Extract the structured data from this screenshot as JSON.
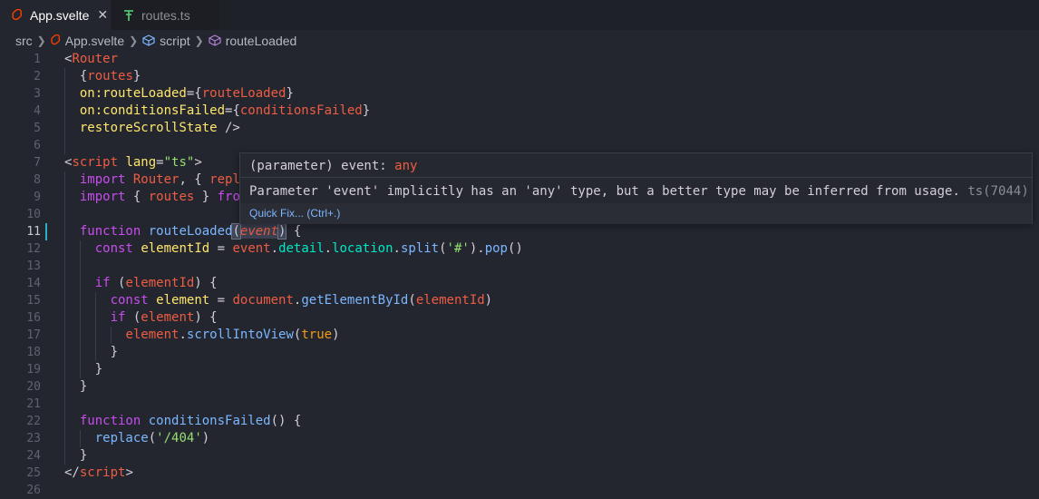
{
  "tabs": [
    {
      "label": "App.svelte",
      "icon": "svelte-icon",
      "active": true
    },
    {
      "label": "routes.ts",
      "icon": "typescript-icon",
      "active": false
    }
  ],
  "breadcrumb": {
    "items": [
      "src",
      "App.svelte",
      "script",
      "routeLoaded"
    ]
  },
  "editor": {
    "line_numbers": [
      "1",
      "2",
      "3",
      "4",
      "5",
      "6",
      "7",
      "8",
      "9",
      "10",
      "11",
      "12",
      "13",
      "14",
      "15",
      "16",
      "17",
      "18",
      "19",
      "20",
      "21",
      "22",
      "23",
      "24",
      "25",
      "26"
    ],
    "active_line": "11"
  },
  "hover": {
    "signature_prefix": "(parameter) event: ",
    "signature_type": "any",
    "message": "Parameter 'event' implicitly has an 'any' type, but a better type may be inferred from usage.",
    "code": "ts(7044)",
    "quick_fix": "Quick Fix... (Ctrl+.)"
  },
  "colors": {
    "background": "#23262e",
    "accent_modified": "#2bb1c4",
    "tag": "#ee5d43",
    "keyword": "#c74ded",
    "function": "#7cb7ff",
    "variable": "#00e8c6",
    "string": "#96e072"
  }
}
